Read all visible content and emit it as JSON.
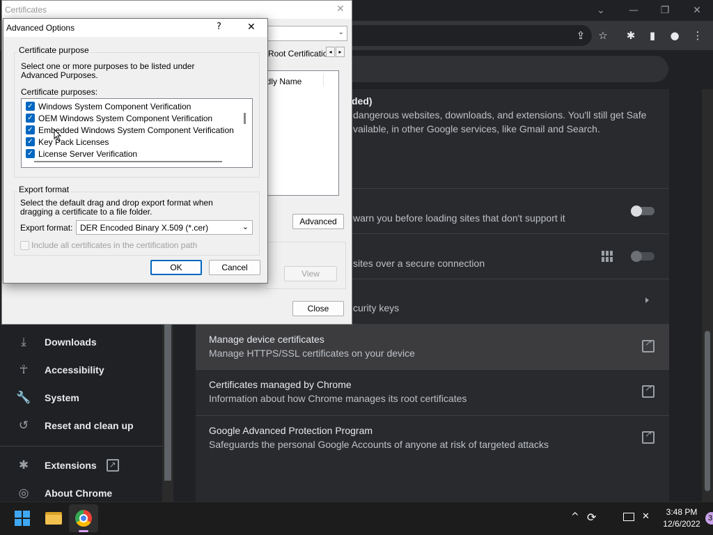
{
  "chrome": {
    "window_controls": {
      "dropdown": "⌄",
      "minimize": "—",
      "restore": "❐",
      "close": "✕"
    },
    "toolbar_icons": {
      "share": "⇪",
      "bookmark": "☆",
      "extensions": "✱",
      "sidepanel": "▮",
      "profile": "●",
      "menu": "⋮"
    }
  },
  "sidebar": {
    "items": [
      {
        "label": "Downloads",
        "icon": "download-icon",
        "glyph": "⤓"
      },
      {
        "label": "Accessibility",
        "icon": "accessibility-icon",
        "glyph": "☥"
      },
      {
        "label": "System",
        "icon": "wrench-icon",
        "glyph": "🔧"
      },
      {
        "label": "Reset and clean up",
        "icon": "restore-icon",
        "glyph": "↺"
      },
      {
        "label": "Extensions",
        "icon": "puzzle-icon",
        "glyph": "✱"
      },
      {
        "label": "About Chrome",
        "icon": "chrome-icon",
        "glyph": "◎"
      }
    ],
    "extensions_link_glyph": "↗"
  },
  "security_page": {
    "enhanced_heading_fragment": "ded)",
    "enhanced_desc_1": "dangerous websites, downloads, and extensions. You'll still get Safe",
    "enhanced_desc_2": "vailable, in other Google services, like Gmail and Search.",
    "https_warn": "warn you before loading sites that don't support it",
    "secure_dns": "sites over a secure connection",
    "security_keys": "curity keys",
    "rows": [
      {
        "title": "Manage device certificates",
        "desc": "Manage HTTPS/SSL certificates on your device"
      },
      {
        "title": "Certificates managed by Chrome",
        "desc": "Information about how Chrome manages its root certificates"
      },
      {
        "title": "Google Advanced Protection Program",
        "desc": "Safeguards the personal Google Accounts of anyone at risk of targeted attacks"
      }
    ]
  },
  "cert_dialog": {
    "title": "Certificates",
    "close_glyph": "✕",
    "tab_visible": "Root Certification",
    "column_header": "ndly Name",
    "advanced_button": "Advanced",
    "view_button": "View",
    "close_button": "Close"
  },
  "advanced_dialog": {
    "title": "Advanced Options",
    "help_glyph": "?",
    "close_glyph": "✕",
    "purpose_group": "Certificate purpose",
    "purpose_desc": "Select one or more purposes to be listed under Advanced Purposes.",
    "purposes_label": "Certificate purposes:",
    "purposes": [
      {
        "label": "Windows System Component Verification",
        "checked": true
      },
      {
        "label": "OEM Windows System Component Verification",
        "checked": true
      },
      {
        "label": "Embedded Windows System Component Verification",
        "checked": true
      },
      {
        "label": "Key Pack Licenses",
        "checked": true
      },
      {
        "label": "License Server Verification",
        "checked": true
      }
    ],
    "export_group": "Export format",
    "export_desc": "Select the default drag and drop export format when dragging a certificate to a file folder.",
    "export_label": "Export format:",
    "export_value": "DER Encoded Binary X.509 (*.cer)",
    "include_all_label": "Include all certificates in the certification path",
    "include_all_checked": false,
    "ok_button": "OK",
    "cancel_button": "Cancel"
  },
  "taskbar": {
    "time": "3:48 PM",
    "date": "12/6/2022",
    "notification_count": "3",
    "apps": [
      "start-icon",
      "file-explorer-icon",
      "chrome-icon"
    ]
  }
}
